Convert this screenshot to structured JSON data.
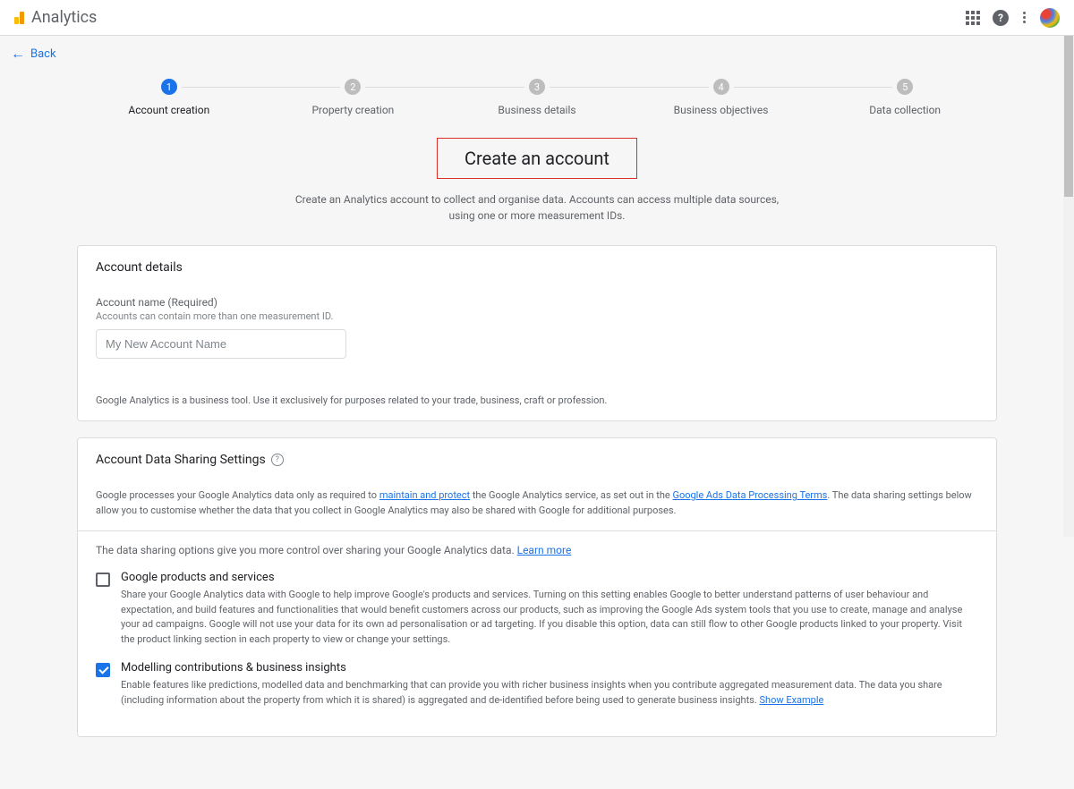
{
  "header": {
    "product_name": "Analytics",
    "back_label": "Back"
  },
  "stepper": {
    "steps": [
      {
        "num": "1",
        "label": "Account creation",
        "active": true
      },
      {
        "num": "2",
        "label": "Property creation",
        "active": false
      },
      {
        "num": "3",
        "label": "Business details",
        "active": false
      },
      {
        "num": "4",
        "label": "Business objectives",
        "active": false
      },
      {
        "num": "5",
        "label": "Data collection",
        "active": false
      }
    ]
  },
  "page": {
    "heading": "Create an account",
    "subtext": "Create an Analytics account to collect and organise data. Accounts can access multiple data sources, using one or more measurement IDs."
  },
  "account_details": {
    "card_title": "Account details",
    "name_label": "Account name (Required)",
    "name_hint": "Accounts can contain more than one measurement ID.",
    "name_placeholder": "My New Account Name",
    "disclaimer": "Google Analytics is a business tool. Use it exclusively for purposes related to your trade, business, craft or profession."
  },
  "data_sharing": {
    "card_title": "Account Data Sharing Settings",
    "desc_pre": "Google processes your Google Analytics data only as required to ",
    "link_maintain": "maintain and protect",
    "desc_mid": " the Google Analytics service, as set out in the ",
    "link_terms": "Google Ads Data Processing Terms",
    "desc_post": ". The data sharing settings below allow you to customise whether the data that you collect in Google Analytics may also be shared with Google for additional purposes.",
    "intro": "The data sharing options give you more control over sharing your Google Analytics data. ",
    "learn_more": "Learn more",
    "options": [
      {
        "title": "Google products and services",
        "checked": false,
        "desc": "Share your Google Analytics data with Google to help improve Google's products and services. Turning on this setting enables Google to better understand patterns of user behaviour and expectation, and build features and functionalities that would benefit customers across our products, such as improving the Google Ads system tools that you use to create, manage and analyse your ad campaigns. Google will not use your data for its own ad personalisation or ad targeting. If you disable this option, data can still flow to other Google products linked to your property. Visit the product linking section in each property to view or change your settings."
      },
      {
        "title": "Modelling contributions & business insights",
        "checked": true,
        "desc_pre": "Enable features like predictions, modelled data and benchmarking that can provide you with richer business insights when you contribute aggregated measurement data. The data you share (including information about the property from which it is shared) is aggregated and de-identified before being used to generate business insights. ",
        "show_example": "Show Example"
      }
    ]
  }
}
